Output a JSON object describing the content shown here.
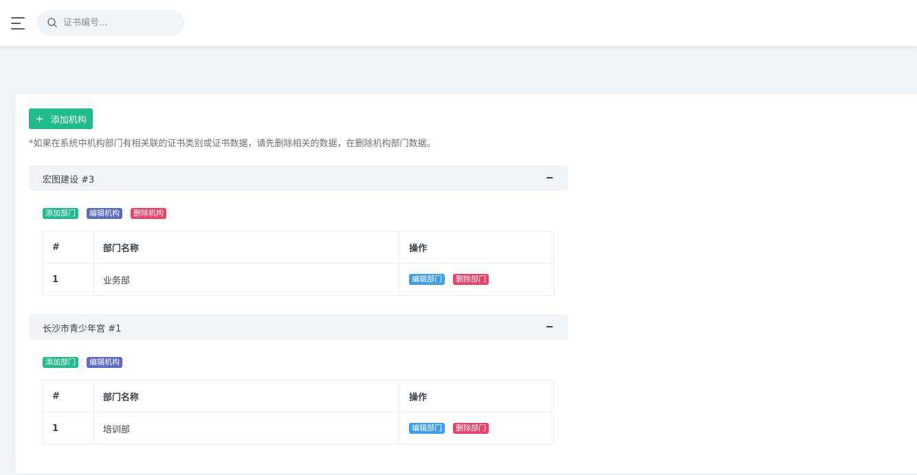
{
  "header": {
    "menu_icon": "hamburger-menu-icon",
    "search": {
      "placeholder": "证书编号...",
      "value": "",
      "icon": "search-icon"
    }
  },
  "main": {
    "add_org_button": {
      "icon": "+",
      "label": "添加机构"
    },
    "notice": "*如果在系统中机构部门有相关联的证书类别或证书数据，请先删除相关的数据，在删除机构部门数据。",
    "organizations": [
      {
        "title": "宏图建设 #3",
        "collapse_icon": "−",
        "actions": {
          "add_dept": "添加部门",
          "edit_org": "编辑机构",
          "delete_org": "删除机构"
        },
        "table": {
          "headers": {
            "num": "#",
            "name": "部门名称",
            "ops": "操作"
          },
          "rows": [
            {
              "num": "1",
              "name": "业务部",
              "edit": "编辑部门",
              "delete": "删除部门"
            }
          ]
        }
      },
      {
        "title": "长沙市青少年宫 #1",
        "collapse_icon": "−",
        "actions": {
          "add_dept": "添加部门",
          "edit_org": "编辑机构"
        },
        "table": {
          "headers": {
            "num": "#",
            "name": "部门名称",
            "ops": "操作"
          },
          "rows": [
            {
              "num": "1",
              "name": "培训部",
              "edit": "编辑部门",
              "delete": "删除部门"
            }
          ]
        }
      }
    ]
  },
  "colors": {
    "green": "#1fbb8a",
    "indigo": "#5c6ac4",
    "red": "#ef4168",
    "blue": "#3d9eed",
    "page_bg": "#f1f4f7"
  }
}
